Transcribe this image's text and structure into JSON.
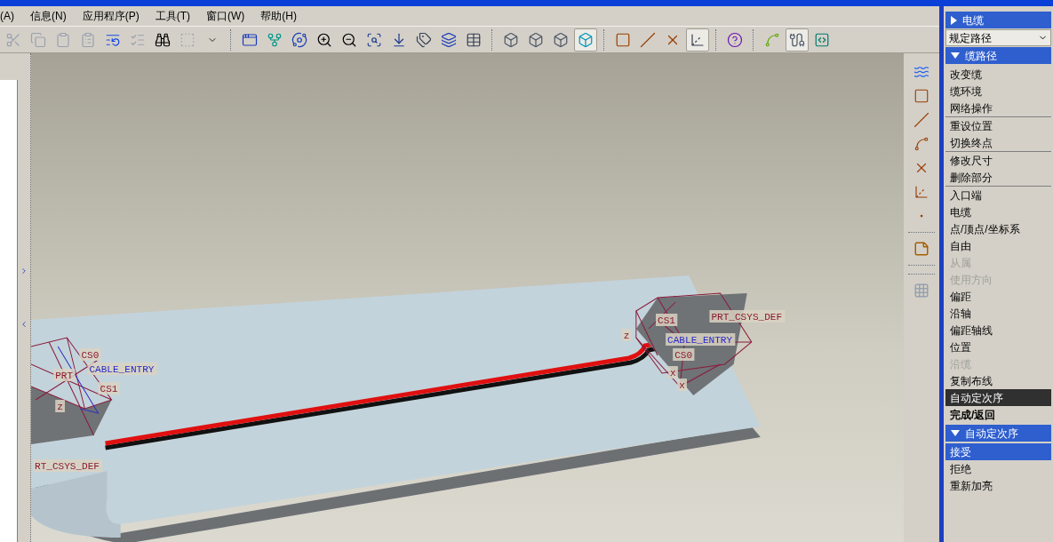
{
  "menubar": [
    {
      "label": "(A)"
    },
    {
      "label": "信息(N)"
    },
    {
      "label": "应用程序(P)"
    },
    {
      "label": "工具(T)"
    },
    {
      "label": "窗口(W)"
    },
    {
      "label": "帮助(H)"
    }
  ],
  "toolbar": [
    {
      "kind": "button",
      "on": false,
      "disabled": true
    },
    {
      "kind": "button",
      "on": false,
      "disabled": true
    },
    {
      "kind": "button",
      "on": false,
      "disabled": true
    },
    {
      "kind": "button",
      "on": false,
      "disabled": true
    },
    {
      "kind": "button",
      "on": false,
      "disabled": false
    },
    {
      "kind": "button",
      "on": false,
      "disabled": true
    },
    {
      "kind": "button",
      "on": false,
      "disabled": false
    },
    {
      "kind": "button",
      "on": false,
      "disabled": true
    },
    {
      "kind": "button",
      "on": false,
      "disabled": false
    },
    {
      "kind": "separator"
    },
    {
      "kind": "button",
      "on": false,
      "disabled": false
    },
    {
      "kind": "button",
      "on": false,
      "disabled": false
    },
    {
      "kind": "button",
      "on": false,
      "disabled": false
    },
    {
      "kind": "button",
      "on": false,
      "disabled": false
    },
    {
      "kind": "button",
      "on": false,
      "disabled": false
    },
    {
      "kind": "button",
      "on": false,
      "disabled": false
    },
    {
      "kind": "button",
      "on": false,
      "disabled": false
    },
    {
      "kind": "button",
      "on": false,
      "disabled": false
    },
    {
      "kind": "button",
      "on": false,
      "disabled": false
    },
    {
      "kind": "button",
      "on": false,
      "disabled": false
    },
    {
      "kind": "separator"
    },
    {
      "kind": "button",
      "on": false,
      "disabled": false
    },
    {
      "kind": "button",
      "on": false,
      "disabled": false
    },
    {
      "kind": "button",
      "on": false,
      "disabled": false
    },
    {
      "kind": "button",
      "on": true,
      "disabled": false
    },
    {
      "kind": "separator"
    },
    {
      "kind": "button",
      "on": false,
      "disabled": false
    },
    {
      "kind": "button",
      "on": false,
      "disabled": false
    },
    {
      "kind": "button",
      "on": false,
      "disabled": false
    },
    {
      "kind": "button",
      "on": true,
      "disabled": false
    },
    {
      "kind": "separator"
    },
    {
      "kind": "button",
      "on": false,
      "disabled": false
    },
    {
      "kind": "separator"
    },
    {
      "kind": "button",
      "on": false,
      "disabled": false
    },
    {
      "kind": "button",
      "on": true,
      "disabled": false
    },
    {
      "kind": "button",
      "on": false,
      "disabled": false
    }
  ],
  "viewport": {
    "labels": [
      {
        "text": "CS0",
        "kind": "csys"
      },
      {
        "text": "CABLE_ENTRY",
        "kind": "port"
      },
      {
        "text": "PRT",
        "kind": "csys"
      },
      {
        "text": "CS1",
        "kind": "csys"
      },
      {
        "text": "z",
        "kind": "csys"
      },
      {
        "text": "RT_CSYS_DEF",
        "kind": "csys"
      },
      {
        "text": "CS1",
        "kind": "csys"
      },
      {
        "text": "z",
        "kind": "csys"
      },
      {
        "text": "PRT_CSYS_DEF",
        "kind": "csys"
      },
      {
        "text": "CABLE_ENTRY",
        "kind": "port"
      },
      {
        "text": "CS0",
        "kind": "csys"
      },
      {
        "text": "x",
        "kind": "csys"
      },
      {
        "text": "x",
        "kind": "csys"
      }
    ]
  },
  "menu_panel": {
    "cable_header": {
      "title": "电缆",
      "expanded": false
    },
    "route_dropdown": {
      "value": "规定路径"
    },
    "route_menu": {
      "title": "缆路径",
      "expanded": true,
      "groups": [
        [
          {
            "label": "改变缆",
            "disabled": false,
            "selected": false
          },
          {
            "label": "缆环境",
            "disabled": false,
            "selected": false
          },
          {
            "label": "网络操作",
            "disabled": false,
            "selected": false
          }
        ],
        [
          {
            "label": "重设位置",
            "disabled": false,
            "selected": false
          },
          {
            "label": "切换终点",
            "disabled": false,
            "selected": false
          }
        ],
        [
          {
            "label": "修改尺寸",
            "disabled": false,
            "selected": false
          },
          {
            "label": "删除部分",
            "disabled": false,
            "selected": false
          }
        ],
        [
          {
            "label": "入口端",
            "disabled": false,
            "selected": false
          },
          {
            "label": "电缆",
            "disabled": false,
            "selected": false
          },
          {
            "label": "点/顶点/坐标系",
            "disabled": false,
            "selected": false
          },
          {
            "label": "自由",
            "disabled": false,
            "selected": false
          },
          {
            "label": "从属",
            "disabled": true,
            "selected": false
          },
          {
            "label": "使用方向",
            "disabled": true,
            "selected": false
          },
          {
            "label": "偏距",
            "disabled": false,
            "selected": false
          },
          {
            "label": "沿轴",
            "disabled": false,
            "selected": false
          },
          {
            "label": "偏距轴线",
            "disabled": false,
            "selected": false
          },
          {
            "label": "位置",
            "disabled": false,
            "selected": false
          },
          {
            "label": "沿缆",
            "disabled": true,
            "selected": false
          },
          {
            "label": "复制布线",
            "disabled": false,
            "selected": false
          },
          {
            "label": "自动定次序",
            "disabled": false,
            "selected": true
          }
        ]
      ],
      "done": "完成/返回"
    },
    "sequence_menu": {
      "title": "自动定次序",
      "expanded": true,
      "items": [
        {
          "label": "接受",
          "selected": true
        },
        {
          "label": "拒绝",
          "selected": false
        },
        {
          "label": "重新加亮",
          "selected": false
        }
      ]
    }
  }
}
